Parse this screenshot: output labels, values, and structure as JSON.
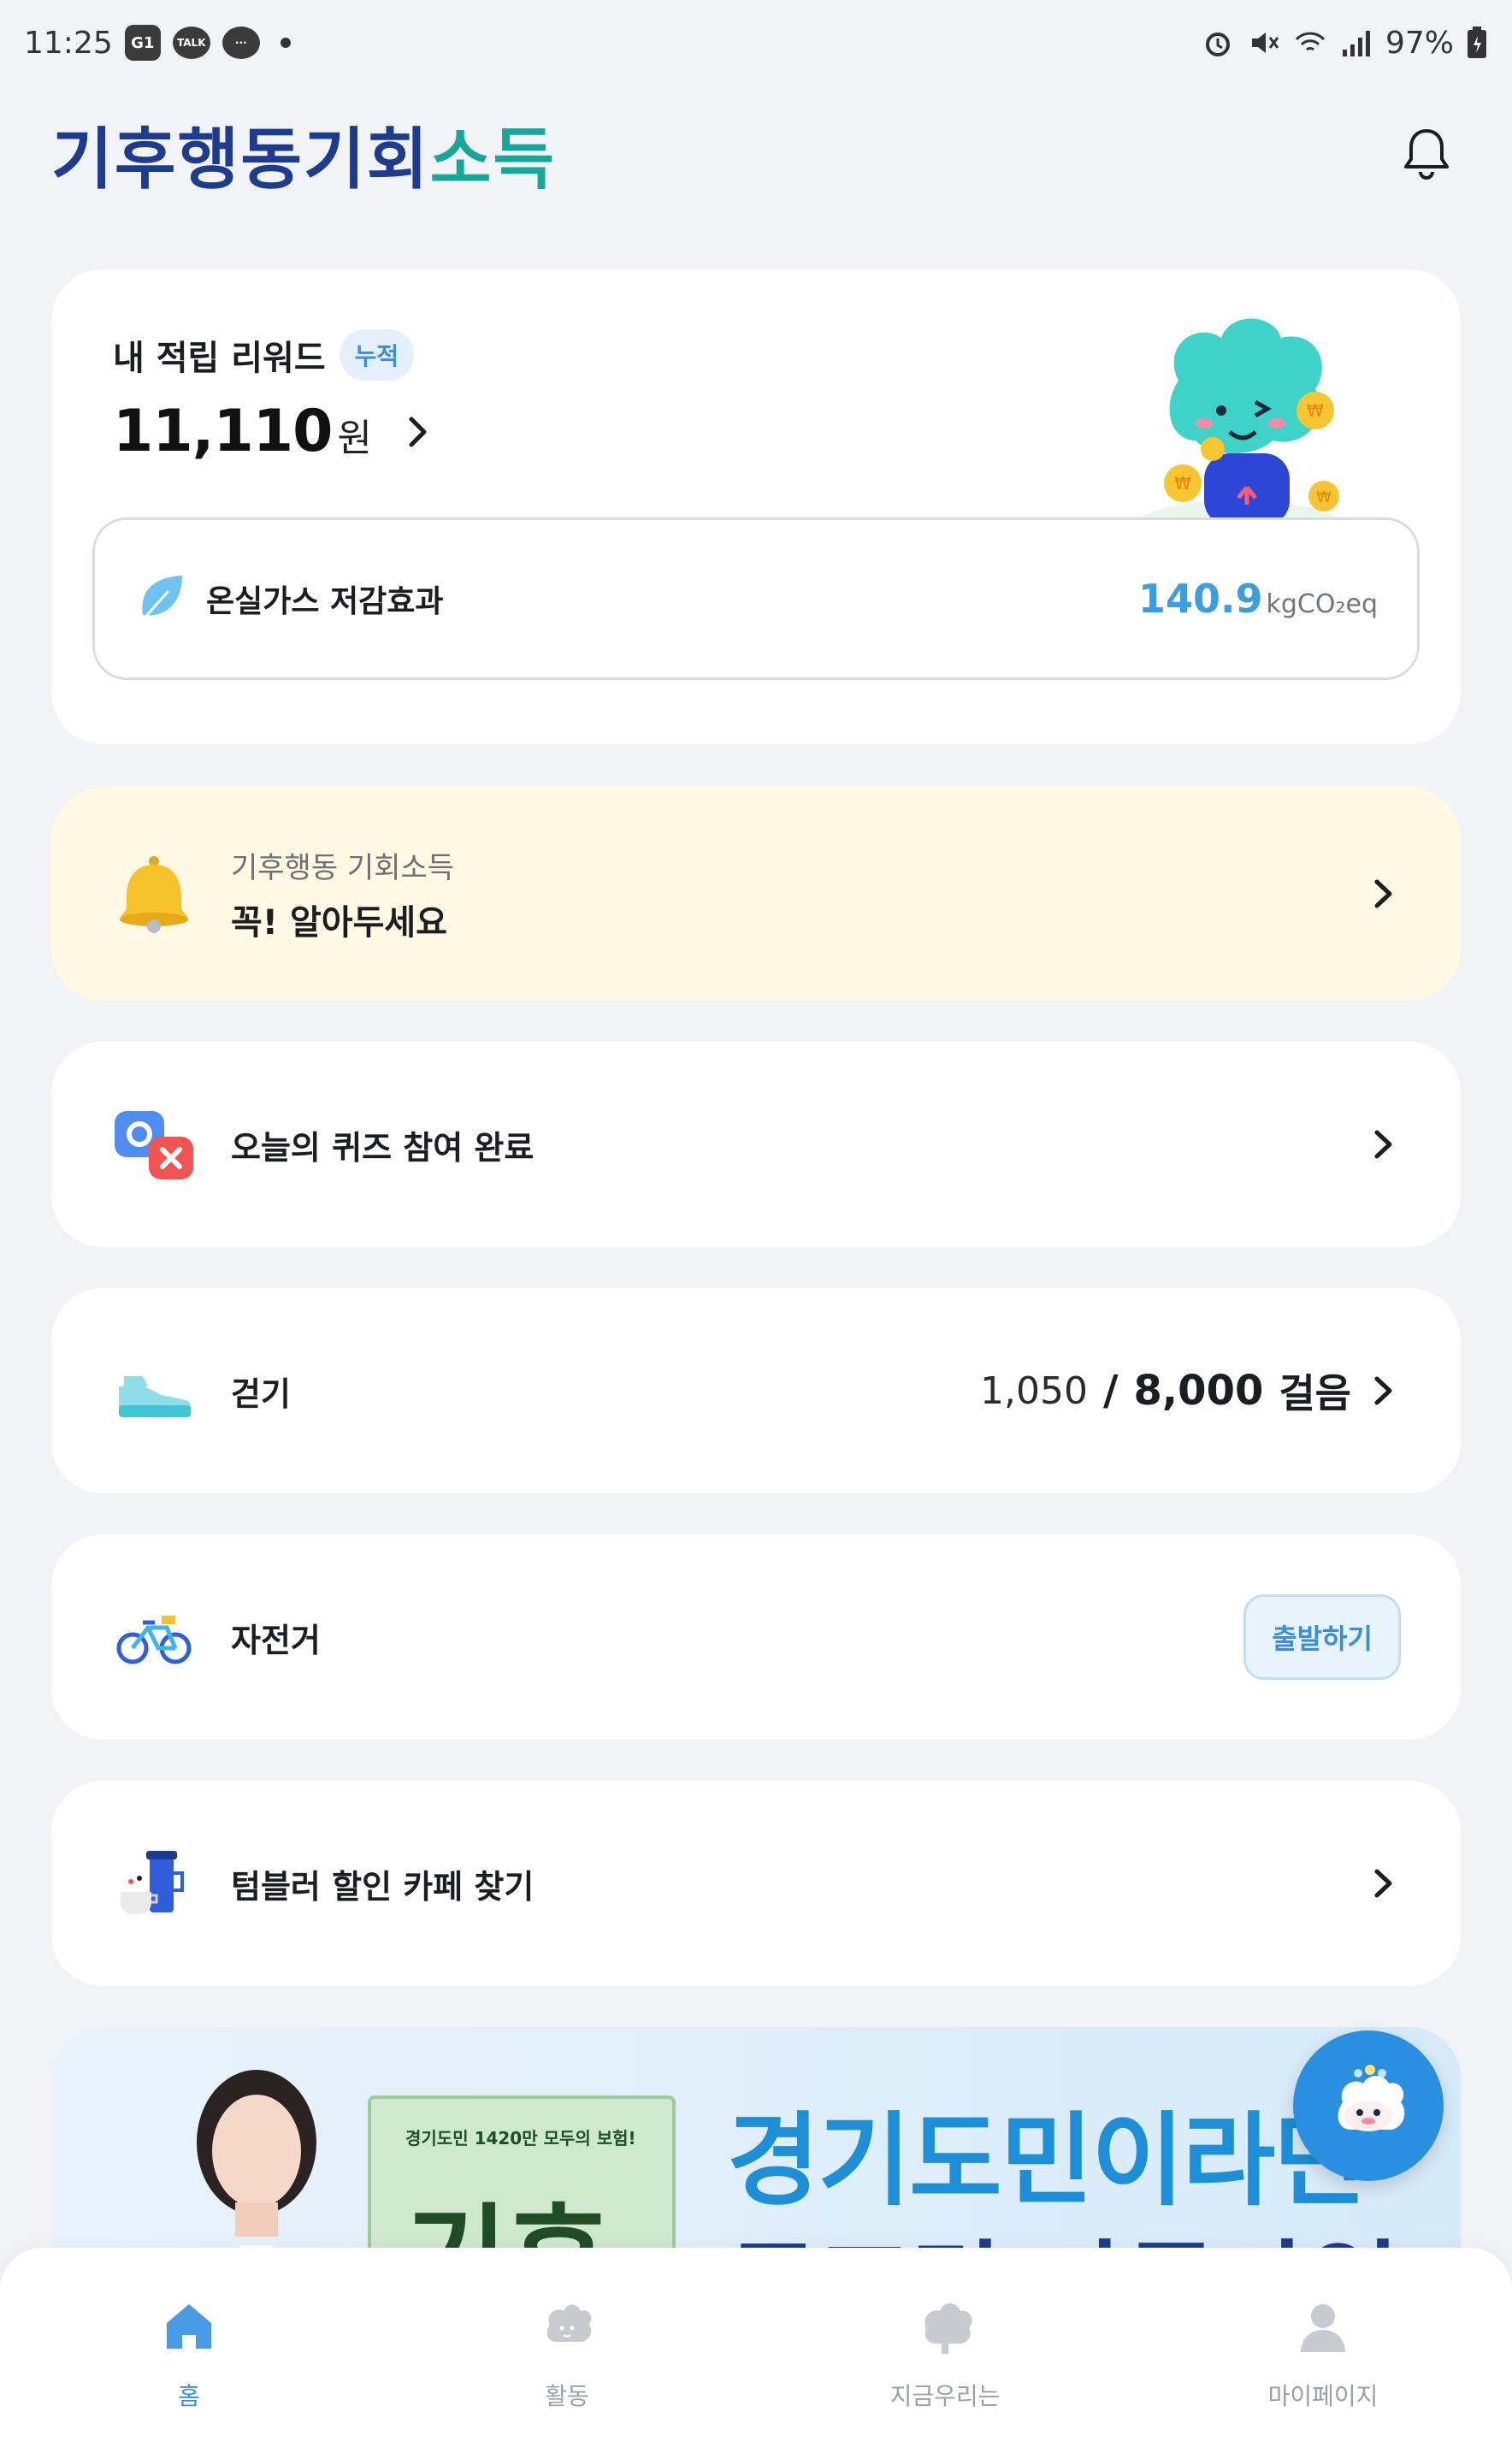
{
  "status_bar": {
    "time": "11:25",
    "badge_g": "G1",
    "talk_label": "TALK",
    "battery": "97%"
  },
  "header": {
    "logo": "기후행동기회소득",
    "logo_part1": "기후행동기회",
    "logo_part2": "소득"
  },
  "reward": {
    "label": "내 적립 리워드",
    "tag": "누적",
    "amount": "11,110",
    "unit": "원",
    "ghg_label": "온실가스 저감효과",
    "ghg_value": "140.9",
    "ghg_unit": "kgCO₂eq"
  },
  "notice": {
    "sub": "기후행동 기회소득",
    "main": "꼭! 알아두세요"
  },
  "quiz": {
    "label": "오늘의 퀴즈 참여 완료"
  },
  "walk": {
    "label": "걷기",
    "current": "1,050",
    "separator": "/",
    "goal": "8,000",
    "unit": "걸음"
  },
  "bike": {
    "label": "자전거",
    "button": "출발하기"
  },
  "tumbler": {
    "label": "텀블러 할인 카페 찾기"
  },
  "banner": {
    "sign_text": "경기도민 1420만 모두의 보험!",
    "sign_big": "기후",
    "headline": "경기도민이라면",
    "headline2": "무조건 자동가입"
  },
  "nav": {
    "items": [
      {
        "label": "홈",
        "icon": "home-icon",
        "active": true
      },
      {
        "label": "활동",
        "icon": "activity-icon",
        "active": false
      },
      {
        "label": "지금우리는",
        "icon": "tree-icon",
        "active": false
      },
      {
        "label": "마이페이지",
        "icon": "person-icon",
        "active": false
      }
    ]
  },
  "colors": {
    "accent_blue": "#3a8fd6",
    "brand_navy": "#1d3b8f",
    "brand_teal": "#16a79a",
    "notice_bg": "#fff8e3"
  }
}
